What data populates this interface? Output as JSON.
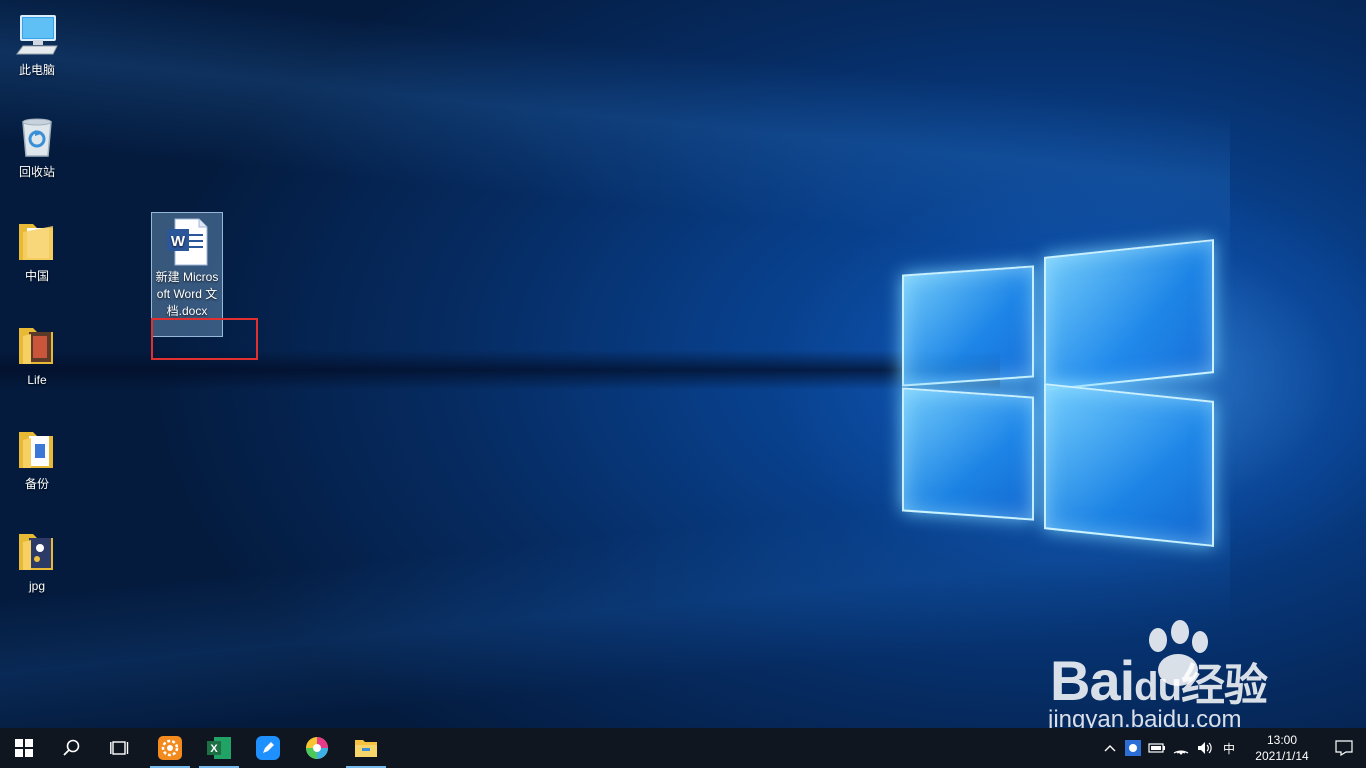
{
  "desktop": {
    "icons": [
      {
        "label": "此电脑",
        "icon": "computer-icon"
      },
      {
        "label": "回收站",
        "icon": "recycle-bin-icon"
      },
      {
        "label": "中国",
        "icon": "folder-icon"
      },
      {
        "label": "Life",
        "icon": "folder-icon"
      },
      {
        "label": "备份",
        "icon": "folder-icon"
      },
      {
        "label": "jpg",
        "icon": "folder-icon"
      }
    ],
    "selected_file": {
      "label": "新建 Microsoft Word 文档.docx",
      "icon": "word-doc-icon",
      "icon_letter": "W"
    }
  },
  "watermark": {
    "logo_text": "Bai",
    "logo_text2": "du",
    "suffix": "经验",
    "site": "jingyan.baidu.com"
  },
  "taskbar": {
    "apps": [
      {
        "name": "app-orange",
        "icon": "gear-app-icon",
        "color": "#f28a1e"
      },
      {
        "name": "excel",
        "icon": "excel-icon",
        "color": "#1d7044",
        "letter": "X"
      },
      {
        "name": "app-blue",
        "icon": "pen-app-icon",
        "color": "#1e90ff"
      },
      {
        "name": "app-color",
        "icon": "pinwheel-icon",
        "color": "#e53b8a"
      },
      {
        "name": "file-explorer",
        "icon": "folder-icon",
        "color": "#f5c242"
      }
    ],
    "tray": {
      "ime": "中",
      "time": "13:00",
      "date": "2021/1/14"
    }
  },
  "colors": {
    "taskbar_bg": "#0f1620",
    "highlight_box": "#e03030",
    "selection_bg": "#99c9ef"
  }
}
